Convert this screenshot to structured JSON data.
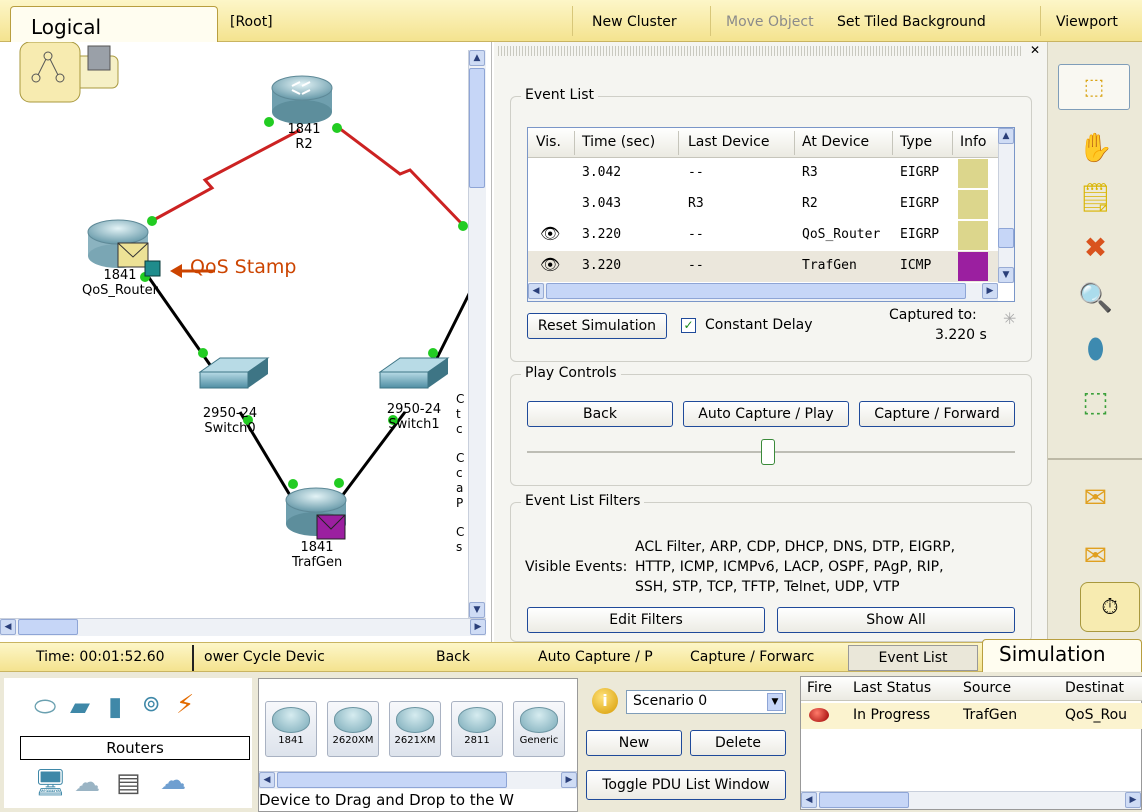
{
  "toolbar": {
    "logical_tab": "Logical",
    "root": "[Root]",
    "new_cluster": "New Cluster",
    "move_object": "Move Object",
    "set_tiled_background": "Set Tiled Background",
    "viewport": "Viewport"
  },
  "topology": {
    "devices": [
      {
        "model": "1841",
        "name": "R2"
      },
      {
        "model": "1841",
        "name": "QoS_Router"
      },
      {
        "model": "2950-24",
        "name": "Switch0"
      },
      {
        "model": "2950-24",
        "name": "Switch1"
      },
      {
        "model": "1841",
        "name": "TrafGen"
      }
    ],
    "annotation": "QoS Stamp",
    "clipped_note": [
      "C",
      "t",
      "c",
      "C",
      "c",
      "a",
      "P",
      "C",
      "s"
    ]
  },
  "event_list": {
    "title": "Event List",
    "columns": [
      "Vis.",
      "Time (sec)",
      "Last Device",
      "At Device",
      "Type",
      "Info"
    ],
    "rows": [
      {
        "vis": false,
        "time": "3.042",
        "last": "--",
        "at": "R3",
        "type": "EIGRP",
        "color": "#dcd68c"
      },
      {
        "vis": false,
        "time": "3.043",
        "last": "R3",
        "at": "R2",
        "type": "EIGRP",
        "color": "#dcd68c"
      },
      {
        "vis": true,
        "time": "3.220",
        "last": "--",
        "at": "QoS_Router",
        "type": "EIGRP",
        "color": "#dcd68c"
      },
      {
        "vis": true,
        "time": "3.220",
        "last": "--",
        "at": "TrafGen",
        "type": "ICMP",
        "color": "#9b1fa0"
      }
    ],
    "reset_label": "Reset Simulation",
    "constant_delay_label": "Constant Delay",
    "constant_delay_checked": true,
    "captured_label": "Captured to:",
    "captured_value": "3.220 s"
  },
  "play_controls": {
    "title": "Play Controls",
    "back": "Back",
    "auto_capture": "Auto Capture / Play",
    "capture_forward": "Capture / Forward"
  },
  "filters": {
    "title": "Event List Filters",
    "visible_label": "Visible Events:",
    "line1": "ACL Filter, ARP, CDP, DHCP, DNS, DTP, EIGRP,",
    "line2": "HTTP, ICMP, ICMPv6, LACP, OSPF, PAgP, RIP,",
    "line3": "SSH, STP, TCP, TFTP, Telnet, UDP, VTP",
    "edit": "Edit Filters",
    "show_all": "Show All"
  },
  "statusbar": {
    "time": "Time: 00:01:52.60",
    "power_cycle": "ower Cycle Devic",
    "back": "Back",
    "auto_capture": "Auto Capture / P",
    "capture_forward": "Capture / Forwarc",
    "event_list": "Event List",
    "simulation": "Simulation"
  },
  "device_panel": {
    "category": "Routers",
    "models": [
      "1841",
      "2620XM",
      "2621XM",
      "2811",
      "Generic"
    ],
    "hint": "Device to Drag and Drop to the W"
  },
  "scenario": {
    "selected": "Scenario 0",
    "new": "New",
    "delete": "Delete",
    "toggle": "Toggle PDU List Window"
  },
  "pdu_list": {
    "columns": [
      "Fire",
      "Last Status",
      "Source",
      "Destinat"
    ],
    "rows": [
      {
        "status": "In Progress",
        "source": "TrafGen",
        "dest": "QoS_Rou"
      }
    ]
  },
  "colors": {
    "toolbar": "#f4e38f",
    "serial_link": "#cc2222",
    "link_dot": "#22cc22",
    "annotation": "#cc4400",
    "icmp": "#9b1fa0",
    "eigrp": "#dcd68c"
  }
}
